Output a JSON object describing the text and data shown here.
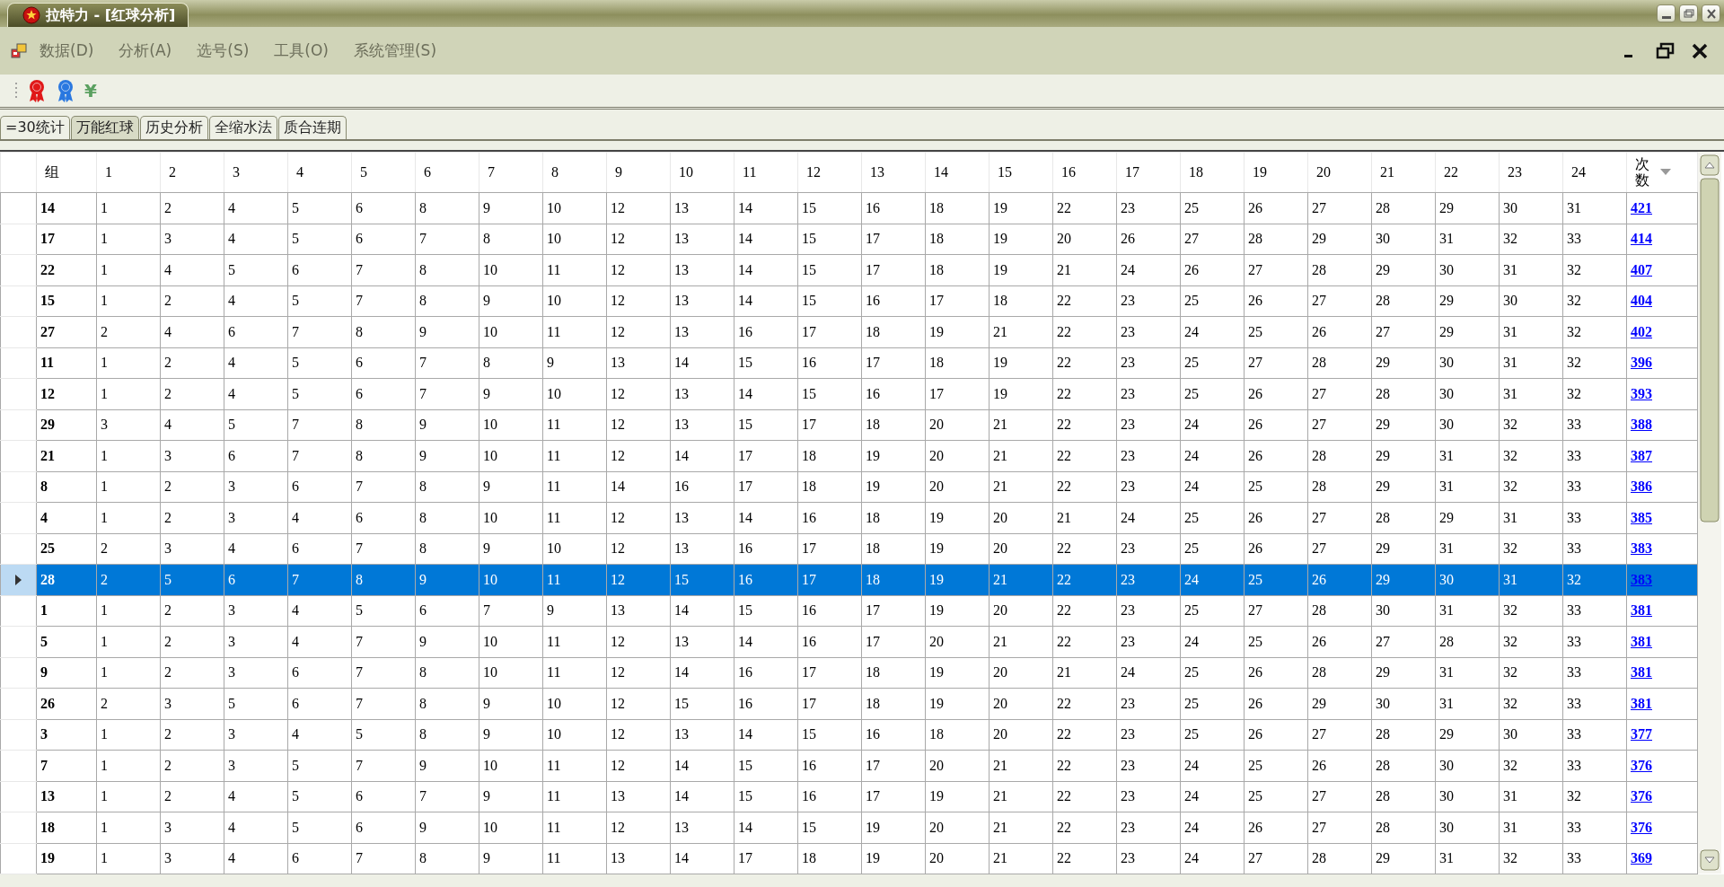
{
  "window": {
    "title": "拉特力 - [红球分析]"
  },
  "menu": [
    "数据(D)",
    "分析(A)",
    "选号(S)",
    "工具(O)",
    "系统管理(S)"
  ],
  "toolbar": [
    {
      "kind": "ribbon",
      "color": "#e01818"
    },
    {
      "kind": "ribbon",
      "color": "#2a78e0"
    },
    {
      "kind": "glyph",
      "text": "¥"
    }
  ],
  "tabs": [
    {
      "label": "=30统计",
      "selected": false
    },
    {
      "label": "万能红球",
      "selected": true
    },
    {
      "label": "历史分析",
      "selected": false
    },
    {
      "label": "全缩水法",
      "selected": false
    },
    {
      "label": "质合连期",
      "selected": false
    }
  ],
  "table": {
    "columns": [
      "组",
      "1",
      "2",
      "3",
      "4",
      "5",
      "6",
      "7",
      "8",
      "9",
      "10",
      "11",
      "12",
      "13",
      "14",
      "15",
      "16",
      "17",
      "18",
      "19",
      "20",
      "21",
      "22",
      "23",
      "24",
      "次数"
    ],
    "rows": [
      {
        "group": "14",
        "numbers": [
          "1",
          "2",
          "4",
          "5",
          "6",
          "8",
          "9",
          "10",
          "12",
          "13",
          "14",
          "15",
          "16",
          "18",
          "19",
          "22",
          "23",
          "25",
          "26",
          "27",
          "28",
          "29",
          "30",
          "31"
        ],
        "count": "421",
        "selected": false
      },
      {
        "group": "17",
        "numbers": [
          "1",
          "3",
          "4",
          "5",
          "6",
          "7",
          "8",
          "10",
          "12",
          "13",
          "14",
          "15",
          "17",
          "18",
          "19",
          "20",
          "26",
          "27",
          "28",
          "29",
          "30",
          "31",
          "32",
          "33"
        ],
        "count": "414",
        "selected": false
      },
      {
        "group": "22",
        "numbers": [
          "1",
          "4",
          "5",
          "6",
          "7",
          "8",
          "10",
          "11",
          "12",
          "13",
          "14",
          "15",
          "17",
          "18",
          "19",
          "21",
          "24",
          "26",
          "27",
          "28",
          "29",
          "30",
          "31",
          "32"
        ],
        "count": "407",
        "selected": false
      },
      {
        "group": "15",
        "numbers": [
          "1",
          "2",
          "4",
          "5",
          "7",
          "8",
          "9",
          "10",
          "12",
          "13",
          "14",
          "15",
          "16",
          "17",
          "18",
          "22",
          "23",
          "25",
          "26",
          "27",
          "28",
          "29",
          "30",
          "32"
        ],
        "count": "404",
        "selected": false
      },
      {
        "group": "27",
        "numbers": [
          "2",
          "4",
          "6",
          "7",
          "8",
          "9",
          "10",
          "11",
          "12",
          "13",
          "16",
          "17",
          "18",
          "19",
          "21",
          "22",
          "23",
          "24",
          "25",
          "26",
          "27",
          "29",
          "31",
          "32"
        ],
        "count": "402",
        "selected": false
      },
      {
        "group": "11",
        "numbers": [
          "1",
          "2",
          "4",
          "5",
          "6",
          "7",
          "8",
          "9",
          "13",
          "14",
          "15",
          "16",
          "17",
          "18",
          "19",
          "22",
          "23",
          "25",
          "27",
          "28",
          "29",
          "30",
          "31",
          "32"
        ],
        "count": "396",
        "selected": false
      },
      {
        "group": "12",
        "numbers": [
          "1",
          "2",
          "4",
          "5",
          "6",
          "7",
          "9",
          "10",
          "12",
          "13",
          "14",
          "15",
          "16",
          "17",
          "19",
          "22",
          "23",
          "25",
          "26",
          "27",
          "28",
          "30",
          "31",
          "32"
        ],
        "count": "393",
        "selected": false
      },
      {
        "group": "29",
        "numbers": [
          "3",
          "4",
          "5",
          "7",
          "8",
          "9",
          "10",
          "11",
          "12",
          "13",
          "15",
          "17",
          "18",
          "20",
          "21",
          "22",
          "23",
          "24",
          "26",
          "27",
          "29",
          "30",
          "32",
          "33"
        ],
        "count": "388",
        "selected": false
      },
      {
        "group": "21",
        "numbers": [
          "1",
          "3",
          "6",
          "7",
          "8",
          "9",
          "10",
          "11",
          "12",
          "14",
          "17",
          "18",
          "19",
          "20",
          "21",
          "22",
          "23",
          "24",
          "26",
          "28",
          "29",
          "31",
          "32",
          "33"
        ],
        "count": "387",
        "selected": false
      },
      {
        "group": "8",
        "numbers": [
          "1",
          "2",
          "3",
          "6",
          "7",
          "8",
          "9",
          "11",
          "14",
          "16",
          "17",
          "18",
          "19",
          "20",
          "21",
          "22",
          "23",
          "24",
          "25",
          "28",
          "29",
          "31",
          "32",
          "33"
        ],
        "count": "386",
        "selected": false
      },
      {
        "group": "4",
        "numbers": [
          "1",
          "2",
          "3",
          "4",
          "6",
          "8",
          "10",
          "11",
          "12",
          "13",
          "14",
          "16",
          "18",
          "19",
          "20",
          "21",
          "24",
          "25",
          "26",
          "27",
          "28",
          "29",
          "31",
          "33"
        ],
        "count": "385",
        "selected": false
      },
      {
        "group": "25",
        "numbers": [
          "2",
          "3",
          "4",
          "6",
          "7",
          "8",
          "9",
          "10",
          "12",
          "13",
          "16",
          "17",
          "18",
          "19",
          "20",
          "22",
          "23",
          "25",
          "26",
          "27",
          "29",
          "31",
          "32",
          "33"
        ],
        "count": "383",
        "selected": false
      },
      {
        "group": "28",
        "numbers": [
          "2",
          "5",
          "6",
          "7",
          "8",
          "9",
          "10",
          "11",
          "12",
          "15",
          "16",
          "17",
          "18",
          "19",
          "21",
          "22",
          "23",
          "24",
          "25",
          "26",
          "29",
          "30",
          "31",
          "32"
        ],
        "count": "383",
        "selected": true
      },
      {
        "group": "1",
        "numbers": [
          "1",
          "2",
          "3",
          "4",
          "5",
          "6",
          "7",
          "9",
          "13",
          "14",
          "15",
          "16",
          "17",
          "19",
          "20",
          "22",
          "23",
          "25",
          "27",
          "28",
          "30",
          "31",
          "32",
          "33"
        ],
        "count": "381",
        "selected": false
      },
      {
        "group": "5",
        "numbers": [
          "1",
          "2",
          "3",
          "4",
          "7",
          "9",
          "10",
          "11",
          "12",
          "13",
          "14",
          "16",
          "17",
          "20",
          "21",
          "22",
          "23",
          "24",
          "25",
          "26",
          "27",
          "28",
          "32",
          "33"
        ],
        "count": "381",
        "selected": false
      },
      {
        "group": "9",
        "numbers": [
          "1",
          "2",
          "3",
          "6",
          "7",
          "8",
          "10",
          "11",
          "12",
          "14",
          "16",
          "17",
          "18",
          "19",
          "20",
          "21",
          "24",
          "25",
          "26",
          "28",
          "29",
          "31",
          "32",
          "33"
        ],
        "count": "381",
        "selected": false
      },
      {
        "group": "26",
        "numbers": [
          "2",
          "3",
          "5",
          "6",
          "7",
          "8",
          "9",
          "10",
          "12",
          "15",
          "16",
          "17",
          "18",
          "19",
          "20",
          "22",
          "23",
          "25",
          "26",
          "29",
          "30",
          "31",
          "32",
          "33"
        ],
        "count": "381",
        "selected": false
      },
      {
        "group": "3",
        "numbers": [
          "1",
          "2",
          "3",
          "4",
          "5",
          "8",
          "9",
          "10",
          "12",
          "13",
          "14",
          "15",
          "16",
          "18",
          "20",
          "22",
          "23",
          "25",
          "26",
          "27",
          "28",
          "29",
          "30",
          "33"
        ],
        "count": "377",
        "selected": false
      },
      {
        "group": "7",
        "numbers": [
          "1",
          "2",
          "3",
          "5",
          "7",
          "9",
          "10",
          "11",
          "12",
          "14",
          "15",
          "16",
          "17",
          "20",
          "21",
          "22",
          "23",
          "24",
          "25",
          "26",
          "28",
          "30",
          "32",
          "33"
        ],
        "count": "376",
        "selected": false
      },
      {
        "group": "13",
        "numbers": [
          "1",
          "2",
          "4",
          "5",
          "6",
          "7",
          "9",
          "11",
          "13",
          "14",
          "15",
          "16",
          "17",
          "19",
          "21",
          "22",
          "23",
          "24",
          "25",
          "27",
          "28",
          "30",
          "31",
          "32"
        ],
        "count": "376",
        "selected": false
      },
      {
        "group": "18",
        "numbers": [
          "1",
          "3",
          "4",
          "5",
          "6",
          "9",
          "10",
          "11",
          "12",
          "13",
          "14",
          "15",
          "19",
          "20",
          "21",
          "22",
          "23",
          "24",
          "26",
          "27",
          "28",
          "30",
          "31",
          "33"
        ],
        "count": "376",
        "selected": false
      },
      {
        "group": "19",
        "numbers": [
          "1",
          "3",
          "4",
          "6",
          "7",
          "8",
          "9",
          "11",
          "13",
          "14",
          "17",
          "18",
          "19",
          "20",
          "21",
          "22",
          "23",
          "24",
          "27",
          "28",
          "29",
          "31",
          "32",
          "33"
        ],
        "count": "369",
        "selected": false
      }
    ]
  }
}
